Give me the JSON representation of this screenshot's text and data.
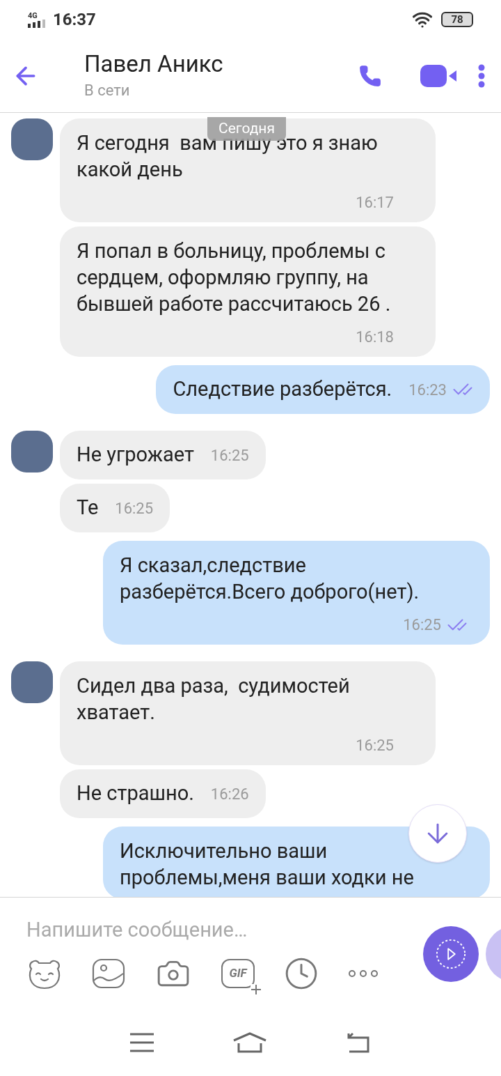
{
  "status_bar": {
    "network": "4G",
    "time": "16:37",
    "battery": "78"
  },
  "header": {
    "name": "Павел Аникс",
    "status": "В сети"
  },
  "date_pill": "Сегодня",
  "messages": [
    {
      "kind": "incoming",
      "avatar": true,
      "text": "Я сегодня  вам пишу это я знаю какой день",
      "time": "16:17",
      "time_inline": false
    },
    {
      "kind": "incoming",
      "avatar": false,
      "text": "Я попал в больницу, проблемы с сердцем, оформляю группу, на бывшей работе рассчитаюсь 26 .",
      "time": "16:18",
      "time_inline": false
    },
    {
      "kind": "outgoing",
      "read": true,
      "text": "Следствие разберётся.",
      "time": "16:23",
      "time_inline": true
    },
    {
      "kind": "incoming",
      "avatar": true,
      "text": "Не угрожает",
      "time": "16:25",
      "time_inline": true
    },
    {
      "kind": "incoming",
      "avatar": false,
      "text": "Те",
      "time": "16:25",
      "time_inline": true
    },
    {
      "kind": "outgoing",
      "read": true,
      "text": "Я сказал,следствие разберётся.Всего доброго(нет).",
      "time": "16:25",
      "time_inline": false
    },
    {
      "kind": "incoming",
      "avatar": true,
      "text": "Сидел два раза,  судимостей хватает.",
      "time": "16:25",
      "time_inline": false
    },
    {
      "kind": "incoming",
      "avatar": false,
      "text": "Не страшно.",
      "time": "16:26",
      "time_inline": true
    },
    {
      "kind": "outgoing",
      "text": "Исключительно ваши проблемы,меня ваши ходки не",
      "time_inline": false
    }
  ],
  "composer": {
    "placeholder": "Напишите сообщение…",
    "gif_label": "GIF"
  }
}
